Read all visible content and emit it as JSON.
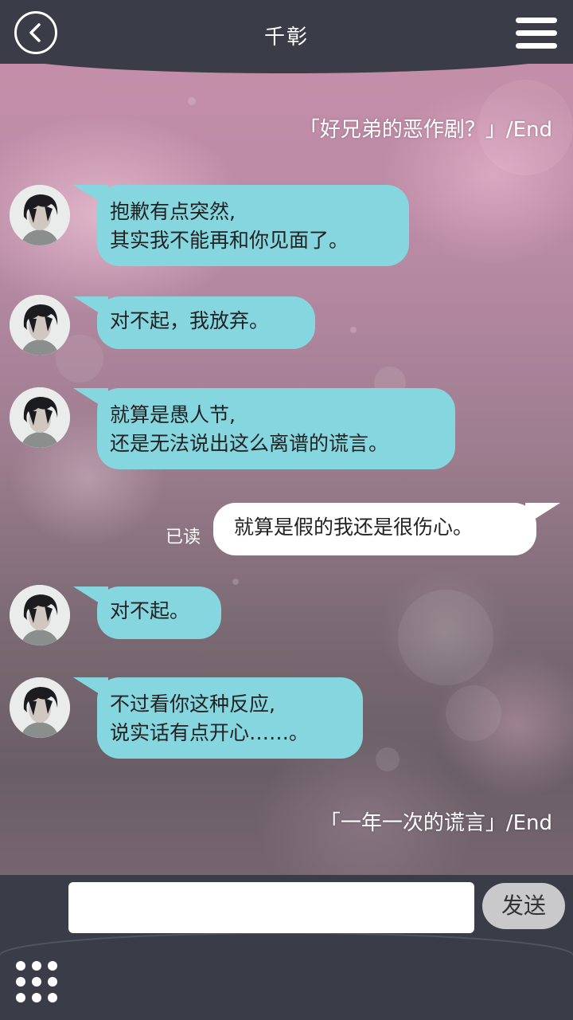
{
  "header": {
    "title": "千彰",
    "back_icon": "back-arrow-icon",
    "menu_icon": "hamburger-menu-icon"
  },
  "chat": {
    "ending_top": "「好兄弟的恶作剧？」/End",
    "messages": [
      {
        "from": "other",
        "line1": "抱歉有点突然,",
        "line2": "其实我不能再和你见面了。"
      },
      {
        "from": "other",
        "line1": "对不起，我放弃。"
      },
      {
        "from": "other",
        "line1": "就算是愚人节,",
        "line2": "还是无法说出这么离谱的谎言。"
      },
      {
        "from": "me",
        "line1": "就算是假的我还是很伤心。",
        "status": "已读"
      },
      {
        "from": "other",
        "line1": "对不起。"
      },
      {
        "from": "other",
        "line1": "不过看你这种反应,",
        "line2": "说实话有点开心……。"
      }
    ],
    "ending_bottom": "「一年一次的谎言」/End"
  },
  "footer": {
    "input_value": "",
    "send_label": "发送",
    "apps_icon": "apps-grid-icon"
  },
  "colors": {
    "bar": "#3a3d47",
    "bubble_other": "#85d6df",
    "bubble_me": "#ffffff",
    "send_bg": "#c9c9cc"
  }
}
